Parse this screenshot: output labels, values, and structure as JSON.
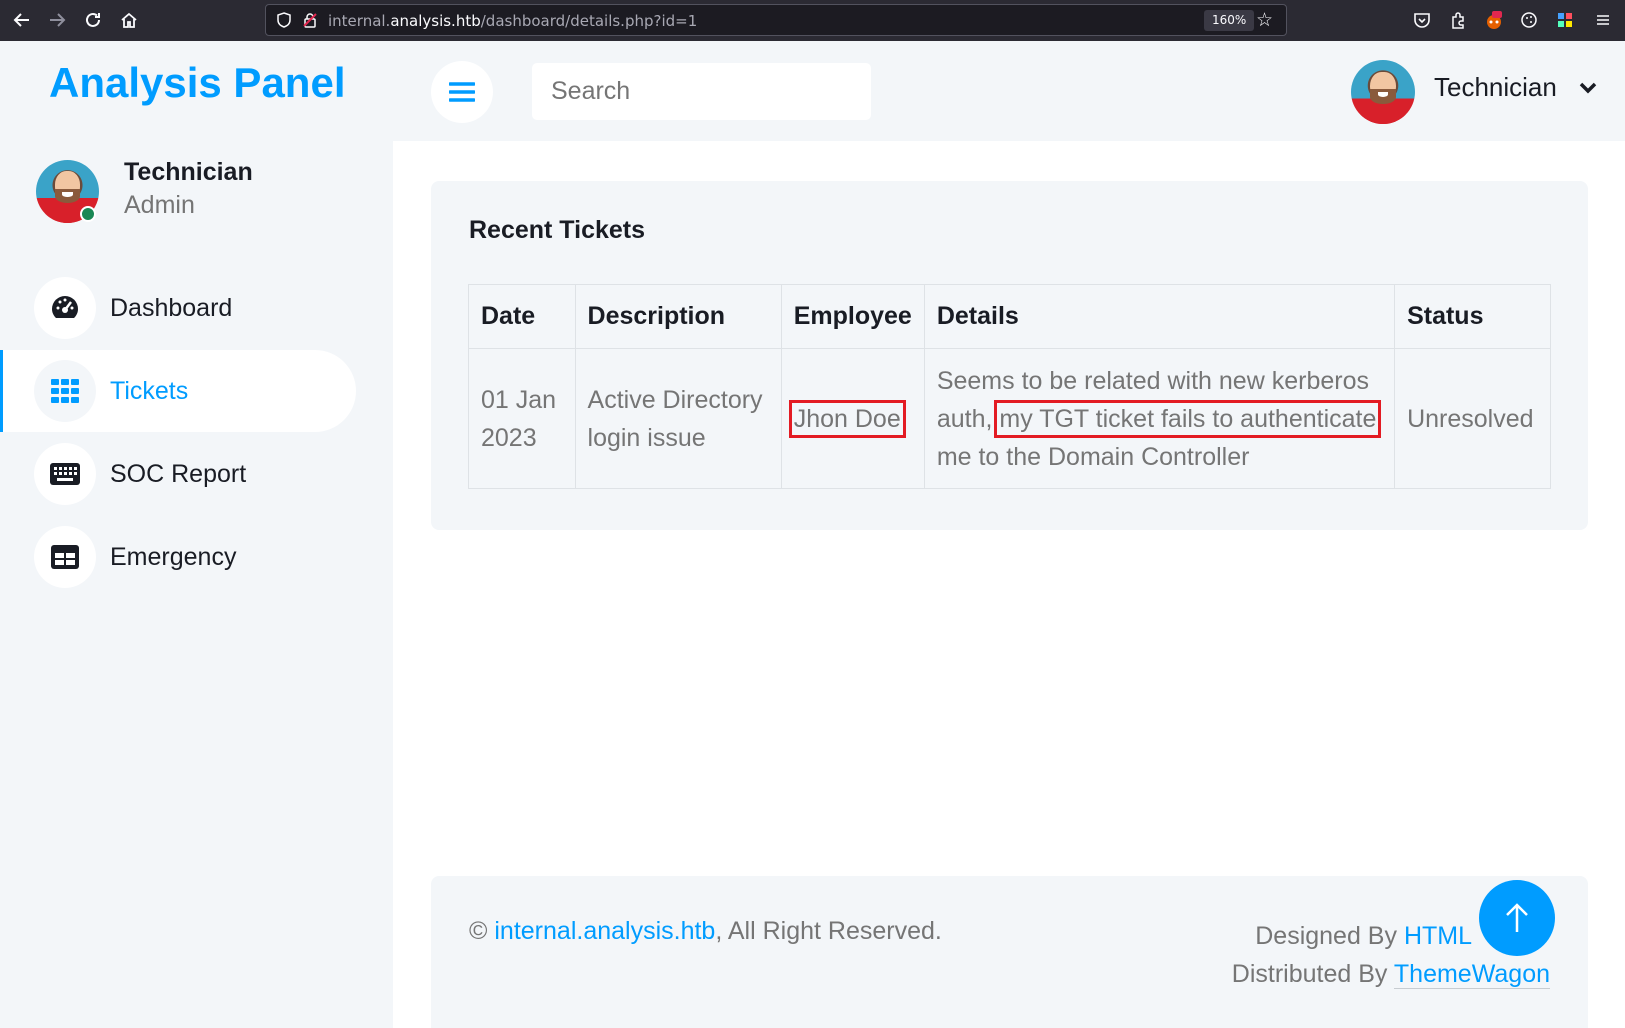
{
  "browser": {
    "url_prefix": "internal.",
    "url_domain": "analysis.htb",
    "url_path": "/dashboard/details.php?id=1",
    "zoom": "160%"
  },
  "brand": "Analysis Panel",
  "user": {
    "name": "Technician",
    "role": "Admin"
  },
  "search": {
    "placeholder": "Search"
  },
  "sidebar": {
    "items": [
      {
        "label": "Dashboard",
        "icon": "gauge-icon",
        "active": false
      },
      {
        "label": "Tickets",
        "icon": "grid-icon",
        "active": true
      },
      {
        "label": "SOC Report",
        "icon": "keyboard-icon",
        "active": false
      },
      {
        "label": "Emergency",
        "icon": "table-icon",
        "active": false
      }
    ]
  },
  "tickets": {
    "title": "Recent Tickets",
    "headers": [
      "Date",
      "Description",
      "Employee",
      "Details",
      "Status"
    ],
    "rows": [
      {
        "date_line1": "01 Jan",
        "date_line2": "2023",
        "desc_line1": "Active Directory",
        "desc_line2": "login issue",
        "employee": "Jhon Doe",
        "details_line1": "Seems to be related with new kerberos",
        "details_pre": "auth,",
        "details_highlight": "my TGT ticket fails to authenticate",
        "details_line3": "me to the Domain Controller",
        "status": "Unresolved"
      }
    ]
  },
  "footer": {
    "copyright_symbol": "©",
    "site_link": "internal.analysis.htb",
    "rights": ", All Right Reserved.",
    "designed_by": "Designed By",
    "designer_link": "HTML",
    "distributed_by": "Distributed By",
    "distributor_link": "ThemeWagon"
  },
  "colors": {
    "accent": "#009cff",
    "highlight_box": "#e31b23",
    "online": "#198754"
  }
}
